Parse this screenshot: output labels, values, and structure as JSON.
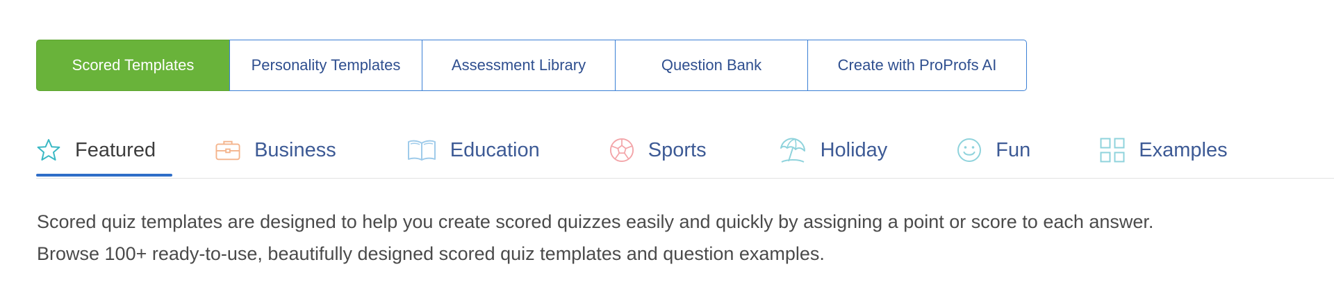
{
  "template_tabs": [
    {
      "label": "Scored Templates",
      "active": true
    },
    {
      "label": "Personality Templates",
      "active": false
    },
    {
      "label": "Assessment Library",
      "active": false
    },
    {
      "label": "Question Bank",
      "active": false
    },
    {
      "label": "Create with ProProfs AI",
      "active": false
    }
  ],
  "categories": [
    {
      "label": "Featured",
      "icon": "star-icon",
      "active": true
    },
    {
      "label": "Business",
      "icon": "briefcase-icon",
      "active": false
    },
    {
      "label": "Education",
      "icon": "book-icon",
      "active": false
    },
    {
      "label": "Sports",
      "icon": "soccer-ball-icon",
      "active": false
    },
    {
      "label": "Holiday",
      "icon": "beach-umbrella-icon",
      "active": false
    },
    {
      "label": "Fun",
      "icon": "smiley-icon",
      "active": false
    },
    {
      "label": "Examples",
      "icon": "grid-icon",
      "active": false
    }
  ],
  "description": {
    "line1": "Scored quiz templates are designed to help you create scored quizzes easily and quickly by assigning a point or score to each answer.",
    "line2": "Browse 100+ ready-to-use, beautifully designed scored quiz templates and question examples."
  },
  "colors": {
    "active_tab_bg": "#69b33a",
    "tab_border": "#3a7fd5",
    "underline": "#2f6ec8"
  }
}
